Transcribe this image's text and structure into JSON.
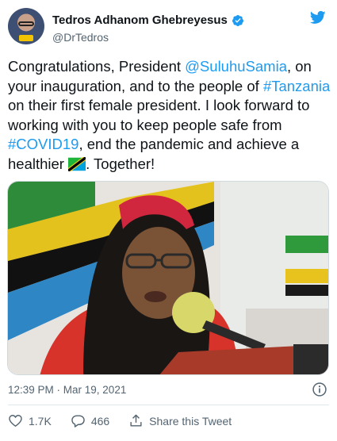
{
  "tweet": {
    "author": {
      "display_name": "Tedros Adhanom Ghebreyesus",
      "handle": "@DrTedros",
      "verified_icon": "verified-badge-icon",
      "avatar": "avatar"
    },
    "brand_icon": "twitter-bird-icon",
    "text": {
      "p1": "Congratulations, President ",
      "mention": "@SuluhuSamia",
      "p2": ", on your inauguration, and to the people of ",
      "hashtag1": "#Tanzania",
      "p3": " on their first female president. I look forward to working with you to keep people safe from ",
      "hashtag2": "#COVID19",
      "p4": ", end the pandemic and achieve a healthier ",
      "p5": ". Together!"
    },
    "emoji": "tanzania-flag-icon",
    "timestamp": "12:39 PM · Mar 19, 2021",
    "actions": {
      "like_count": "1.7K",
      "reply_count": "466",
      "share_label": "Share this Tweet"
    },
    "colors": {
      "accent": "#1d9bf0",
      "text": "#0f1419",
      "muted": "#536471"
    }
  }
}
